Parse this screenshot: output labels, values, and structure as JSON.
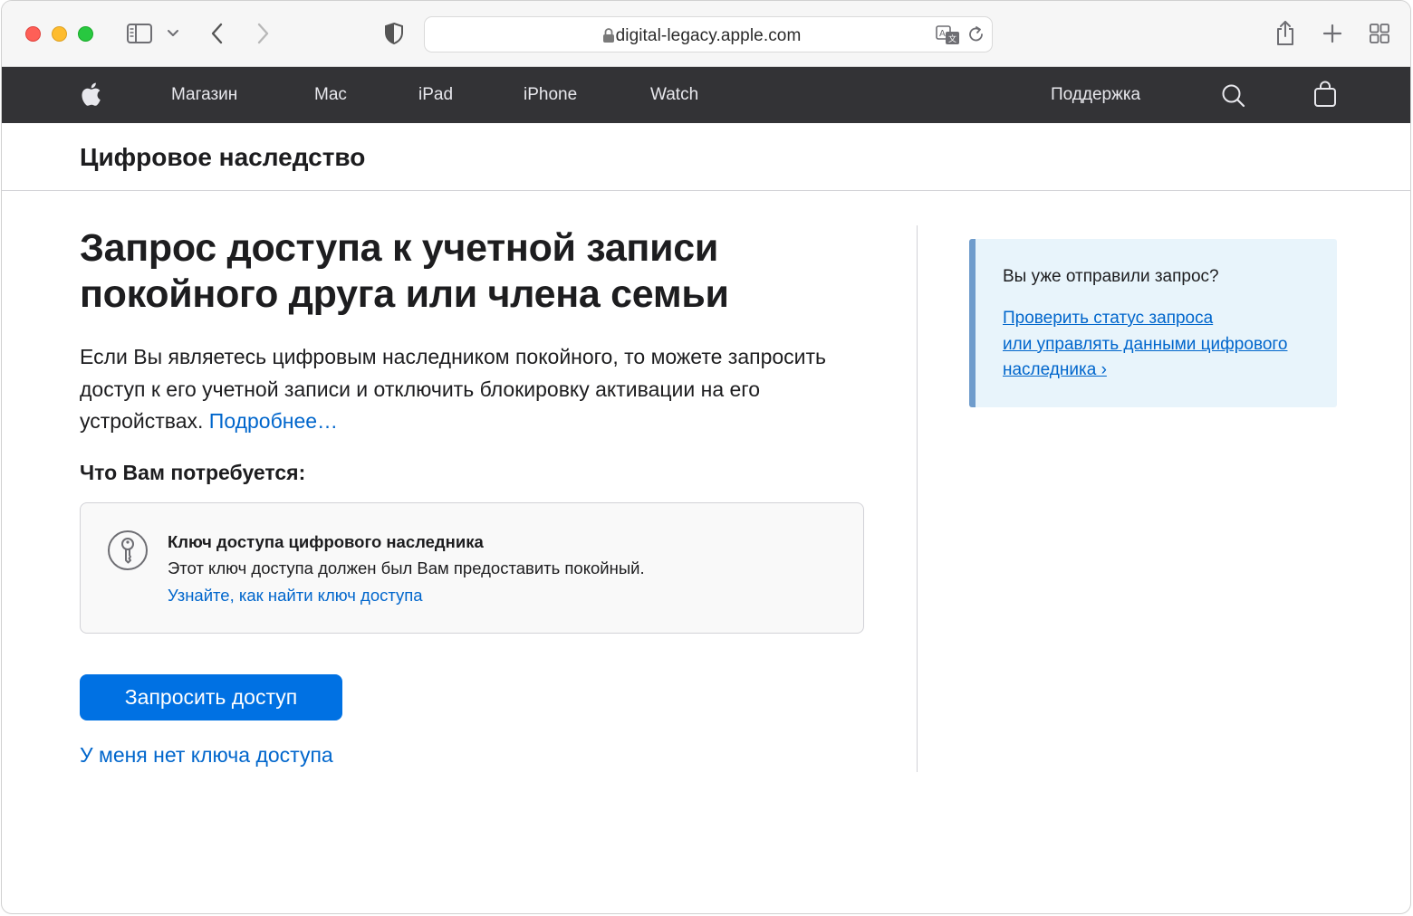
{
  "browser": {
    "url": "digital-legacy.apple.com"
  },
  "globalnav": {
    "items": [
      "Магазин",
      "Mac",
      "iPad",
      "iPhone",
      "Watch"
    ],
    "support": "Поддержка"
  },
  "localnav": {
    "title": "Цифровое наследство"
  },
  "main": {
    "headline_line1": "Запрос доступа к учетной записи",
    "headline_line2": "покойного друга или члена семьи",
    "intro": "Если Вы являетесь цифровым наследником покойного, то можете запросить доступ к его учетной записи и отключить блокировку активации на его устройствах.",
    "intro_link": "Подробнее…",
    "need_title": "Что Вам потребуется:",
    "need_item_title": "Ключ доступа цифрового наследника",
    "need_item_desc": "Этот ключ доступа должен был Вам предоставить покойный.",
    "need_item_link": "Узнайте, как найти ключ доступа",
    "request_button": "Запросить доступ",
    "no_key_link": "У меня нет ключа доступа"
  },
  "sidebar": {
    "title": "Вы уже отправили запрос?",
    "link_line1": "Проверить статус запроса",
    "link_line2": "или управлять данными цифрового",
    "link_line3": "наследника ›"
  },
  "colors": {
    "accent": "#0071e3",
    "link": "#0066cc",
    "nav_bg": "#333336",
    "callout_bg": "#e8f4fb",
    "callout_border": "#6f9ccc"
  },
  "icons": [
    "sidebar-icon",
    "chevron-down-icon",
    "back-icon",
    "forward-icon",
    "shield-icon",
    "lock-icon",
    "translate-icon",
    "reload-icon",
    "share-icon",
    "plus-icon",
    "tabs-grid-icon",
    "apple-logo-icon",
    "search-icon",
    "bag-icon",
    "key-icon"
  ]
}
